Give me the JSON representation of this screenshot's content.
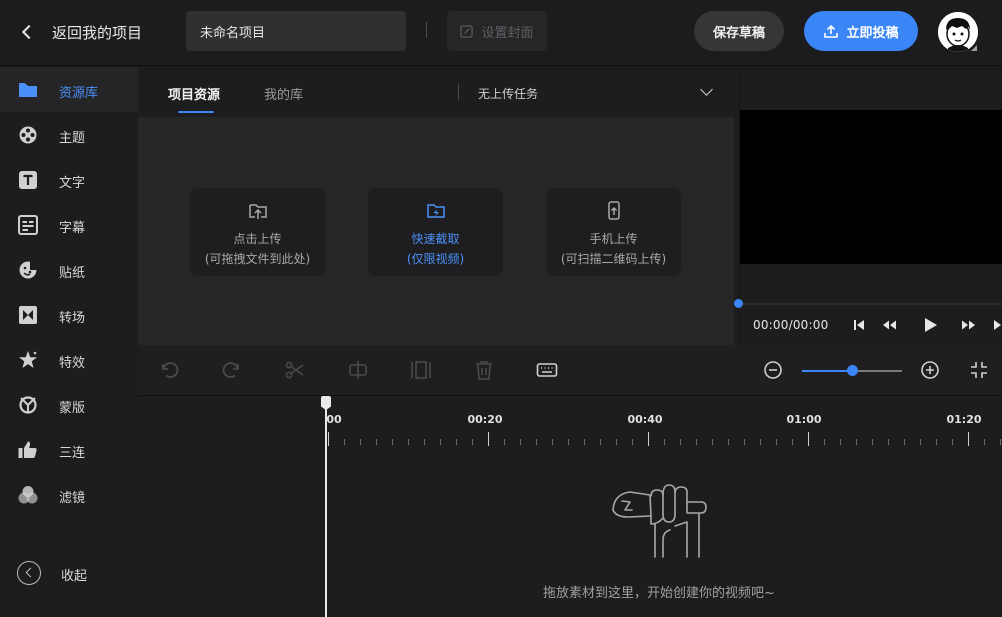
{
  "header": {
    "back_label": "返回我的项目",
    "project_name": "未命名项目",
    "cover_label": "设置封面",
    "save_label": "保存草稿",
    "publish_label": "立即投稿"
  },
  "sidebar": {
    "items": [
      {
        "label": "资源库",
        "icon": "folder-icon"
      },
      {
        "label": "主题",
        "icon": "film-reel-icon"
      },
      {
        "label": "文字",
        "icon": "text-icon"
      },
      {
        "label": "字幕",
        "icon": "subtitle-icon"
      },
      {
        "label": "贴纸",
        "icon": "sticker-icon"
      },
      {
        "label": "转场",
        "icon": "transition-icon"
      },
      {
        "label": "特效",
        "icon": "effects-icon"
      },
      {
        "label": "蒙版",
        "icon": "mask-icon"
      },
      {
        "label": "三连",
        "icon": "thumbs-up-icon"
      },
      {
        "label": "滤镜",
        "icon": "filter-icon"
      }
    ],
    "collapse_label": "收起"
  },
  "resources": {
    "tabs": [
      "项目资源",
      "我的库"
    ],
    "upload_status": "无上传任务",
    "cards": [
      {
        "line1": "点击上传",
        "line2": "(可拖拽文件到此处)"
      },
      {
        "line1": "快速截取",
        "line2": "(仅限视频)"
      },
      {
        "line1": "手机上传",
        "line2": "(可扫描二维码上传)"
      }
    ]
  },
  "preview": {
    "time_current": "00:00",
    "time_total": "00:00"
  },
  "timeline": {
    "ruler_labels": [
      "00",
      "00:20",
      "00:40",
      "01:00",
      "01:20"
    ],
    "empty_message": "拖放素材到这里，开始创建你的视频吧~"
  },
  "colors": {
    "accent": "#3a86f7",
    "background": "#1a1a1a"
  }
}
